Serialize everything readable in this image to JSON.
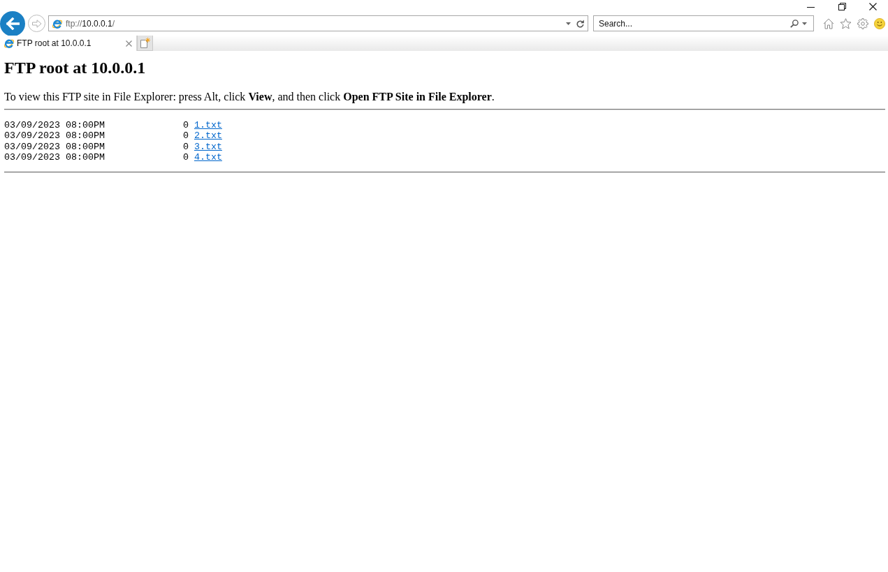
{
  "address_bar": {
    "scheme": "ftp://",
    "host": "10.0.0.1",
    "path": "/"
  },
  "search": {
    "placeholder": "Search..."
  },
  "tabs": [
    {
      "title": "FTP root at 10.0.0.1",
      "selected": true
    }
  ],
  "page": {
    "heading": "FTP root at 10.0.0.1",
    "instructions": "To view this FTP site in File Explorer: press Alt, click **View**, and then click **Open FTP Site in File Explorer**.",
    "listing": [
      {
        "date": "03/09/2023 08:00PM",
        "size": "0",
        "name": "1.txt"
      },
      {
        "date": "03/09/2023 08:00PM",
        "size": "0",
        "name": "2.txt"
      },
      {
        "date": "03/09/2023 08:00PM",
        "size": "0",
        "name": "3.txt"
      },
      {
        "date": "03/09/2023 08:00PM",
        "size": "0",
        "name": "4.txt"
      }
    ]
  }
}
